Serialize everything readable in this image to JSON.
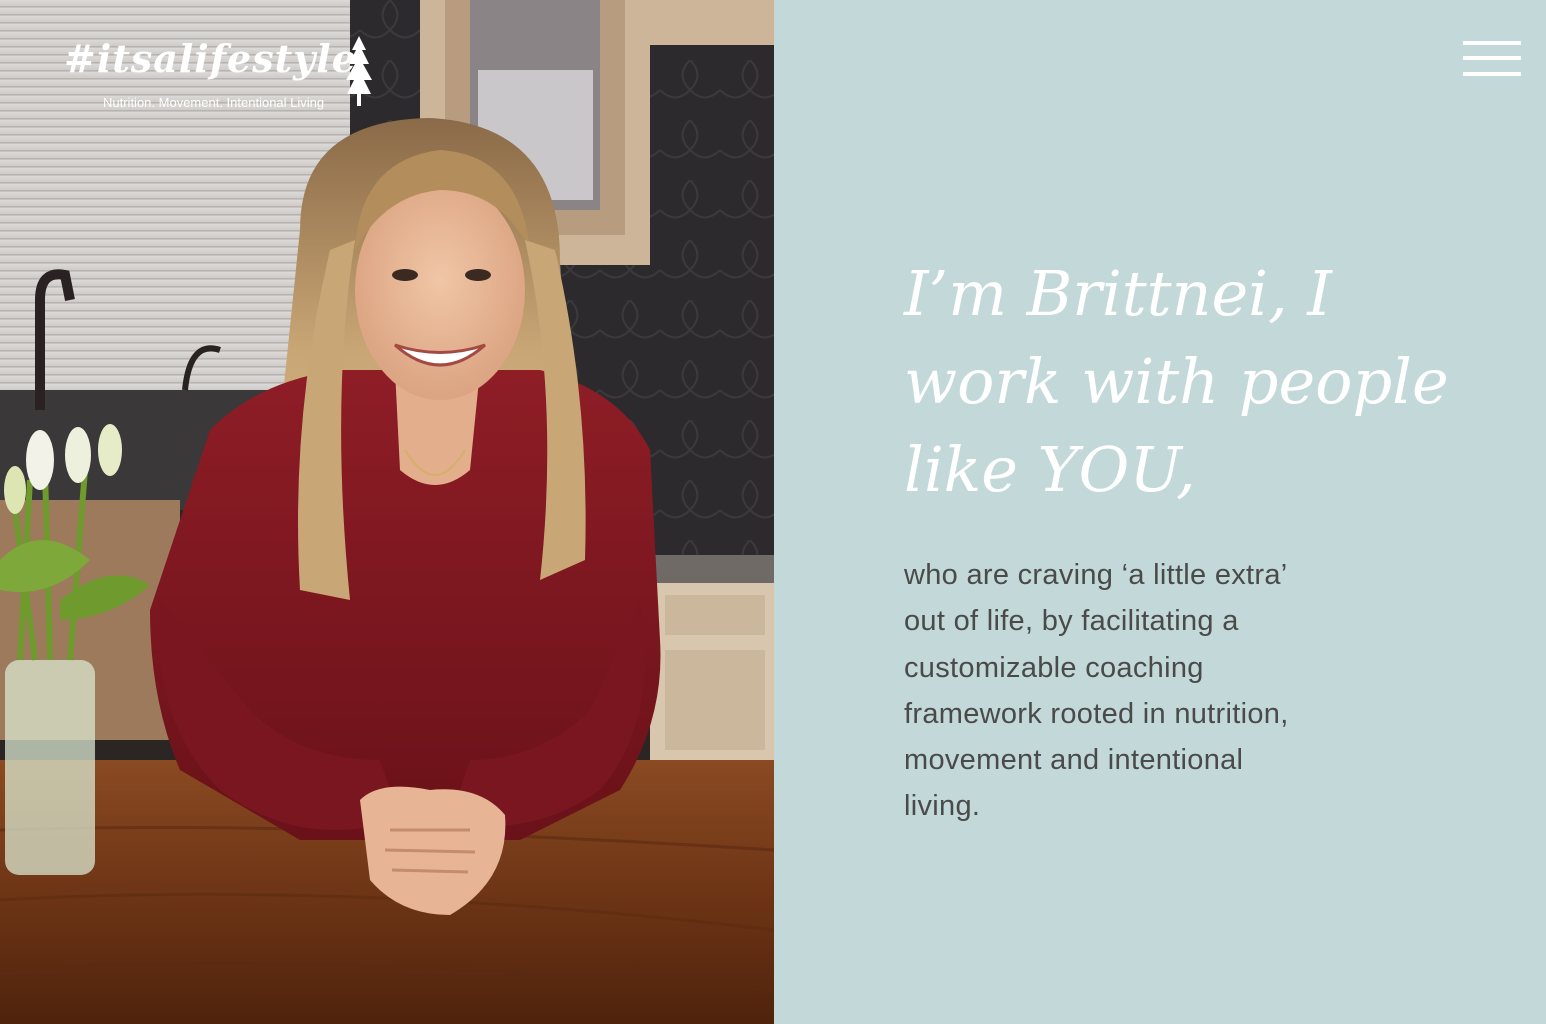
{
  "brand": {
    "logo_text": "#itsalifestyle",
    "tagline": "Nutrition. Movement. Intentional Living"
  },
  "photo": {
    "description_icon": "portrait-photo"
  },
  "nav": {
    "menu_icon": "hamburger-menu-icon"
  },
  "hero": {
    "headline": "I’m Brittnei, I work with people like YOU,",
    "body": "who are craving ‘a little extra’ out of life, by facilitating a customizable coaching framework rooted in nutrition, movement and intentional living."
  },
  "colors": {
    "panel_background": "#c3d8d8",
    "headline_text": "#ffffff",
    "body_text": "#4a4a4a",
    "menu_icon": "#ffffff"
  }
}
